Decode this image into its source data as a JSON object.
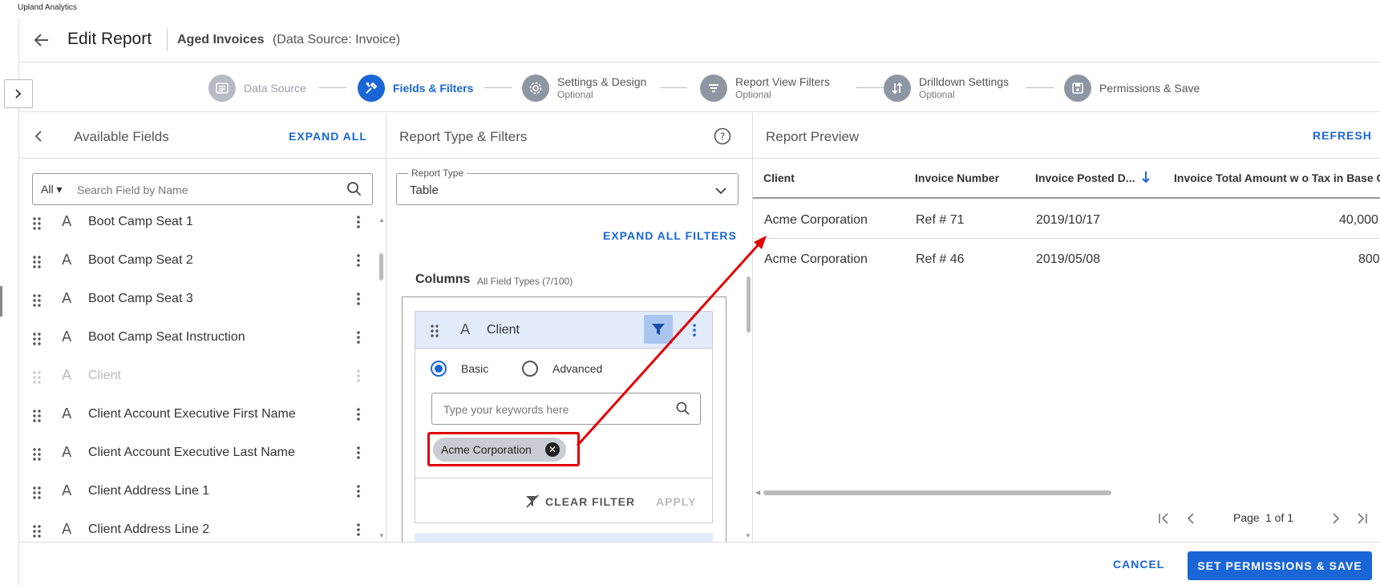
{
  "app": {
    "brand": "Upland Analytics"
  },
  "header": {
    "title": "Edit Report",
    "report_name": "Aged Invoices",
    "data_source": "(Data Source: Invoice)"
  },
  "steps": [
    {
      "label": "Data Source",
      "optional": ""
    },
    {
      "label": "Fields & Filters",
      "optional": ""
    },
    {
      "label": "Settings & Design",
      "optional": "Optional"
    },
    {
      "label": "Report View Filters",
      "optional": "Optional"
    },
    {
      "label": "Drilldown Settings",
      "optional": "Optional"
    },
    {
      "label": "Permissions & Save",
      "optional": ""
    }
  ],
  "available_fields": {
    "title": "Available Fields",
    "expand_all": "EXPAND ALL",
    "search": {
      "scope": "All",
      "placeholder": "Search Field by Name"
    },
    "items": [
      "Boot Camp Seat 1",
      "Boot Camp Seat 2",
      "Boot Camp Seat 3",
      "Boot Camp Seat Instruction",
      "Client",
      "Client Account Executive First Name",
      "Client Account Executive Last Name",
      "Client Address Line 1",
      "Client Address Line 2"
    ]
  },
  "report_type": {
    "title": "Report Type & Filters",
    "type_label": "Report Type",
    "type_value": "Table",
    "expand_all_filters": "EXPAND ALL FILTERS",
    "columns_title": "Columns",
    "columns_sub": "All Field Types (7/100)",
    "column_name": "Client",
    "basic": "Basic",
    "advanced": "Advanced",
    "keyword_placeholder": "Type your keywords here",
    "chip": "Acme Corporation",
    "clear_filter": "CLEAR FILTER",
    "apply": "APPLY"
  },
  "preview": {
    "title": "Report Preview",
    "refresh": "REFRESH",
    "headers": [
      "Client",
      "Invoice Number",
      "Invoice Posted D...",
      "Invoice Total Amount w o Tax in Base C"
    ],
    "rows": [
      [
        "Acme Corporation",
        "Ref # 71",
        "2019/10/17",
        "40,000"
      ],
      [
        "Acme Corporation",
        "Ref # 46",
        "2019/05/08",
        "800"
      ]
    ],
    "page_label": "Page",
    "page_value": "1 of 1"
  },
  "footer": {
    "cancel": "CANCEL",
    "save": "SET PERMISSIONS & SAVE"
  },
  "colors": {
    "accent": "#1a66d6",
    "highlight": "#e00000"
  }
}
